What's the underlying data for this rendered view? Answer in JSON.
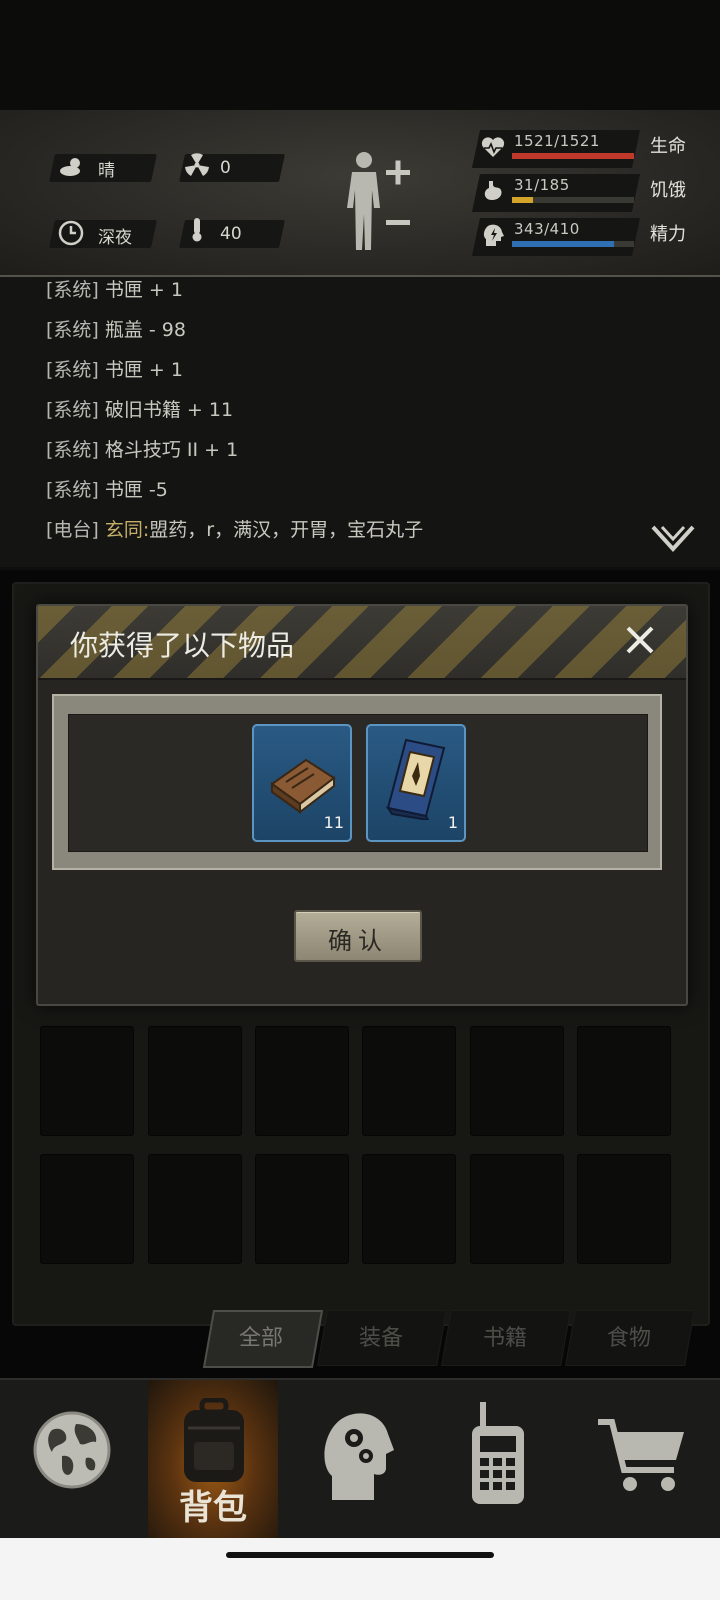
{
  "header": {
    "weather": "晴",
    "radiation": "0",
    "time_of_day": "深夜",
    "temperature": "40",
    "health": {
      "value": "1521/1521",
      "label": "生命",
      "fraction": 1.0,
      "color": "#c0392b"
    },
    "hunger": {
      "value": "31/185",
      "label": "饥饿",
      "fraction": 0.17,
      "color": "#d4a32a"
    },
    "energy": {
      "value": "343/410",
      "label": "精力",
      "fraction": 0.84,
      "color": "#2f6fb3"
    }
  },
  "log": [
    {
      "tag": "[系统]",
      "speaker": "",
      "text": "书匣 + 1",
      "partial": true
    },
    {
      "tag": "[系统]",
      "speaker": "",
      "text": "瓶盖 - 98"
    },
    {
      "tag": "[系统]",
      "speaker": "",
      "text": "书匣 + 1"
    },
    {
      "tag": "[系统]",
      "speaker": "",
      "text": "破旧书籍 + 11"
    },
    {
      "tag": "[系统]",
      "speaker": "",
      "text": "格斗技巧 II + 1"
    },
    {
      "tag": "[系统]",
      "speaker": "",
      "text": "书匣 -5"
    },
    {
      "tag": "[电台]",
      "speaker": "玄同:",
      "text": "盟药，r，满汉，开胃，宝石丸子"
    }
  ],
  "modal": {
    "title": "你获得了以下物品",
    "items": [
      {
        "icon": "old-book-icon",
        "count": "11"
      },
      {
        "icon": "skill-book-icon",
        "count": "1"
      }
    ],
    "confirm_label": "确认"
  },
  "tabs": [
    {
      "label": "全部",
      "active": true
    },
    {
      "label": "装备",
      "active": false
    },
    {
      "label": "书籍",
      "active": false
    },
    {
      "label": "食物",
      "active": false
    }
  ],
  "nav": {
    "backpack_label": "背包"
  }
}
